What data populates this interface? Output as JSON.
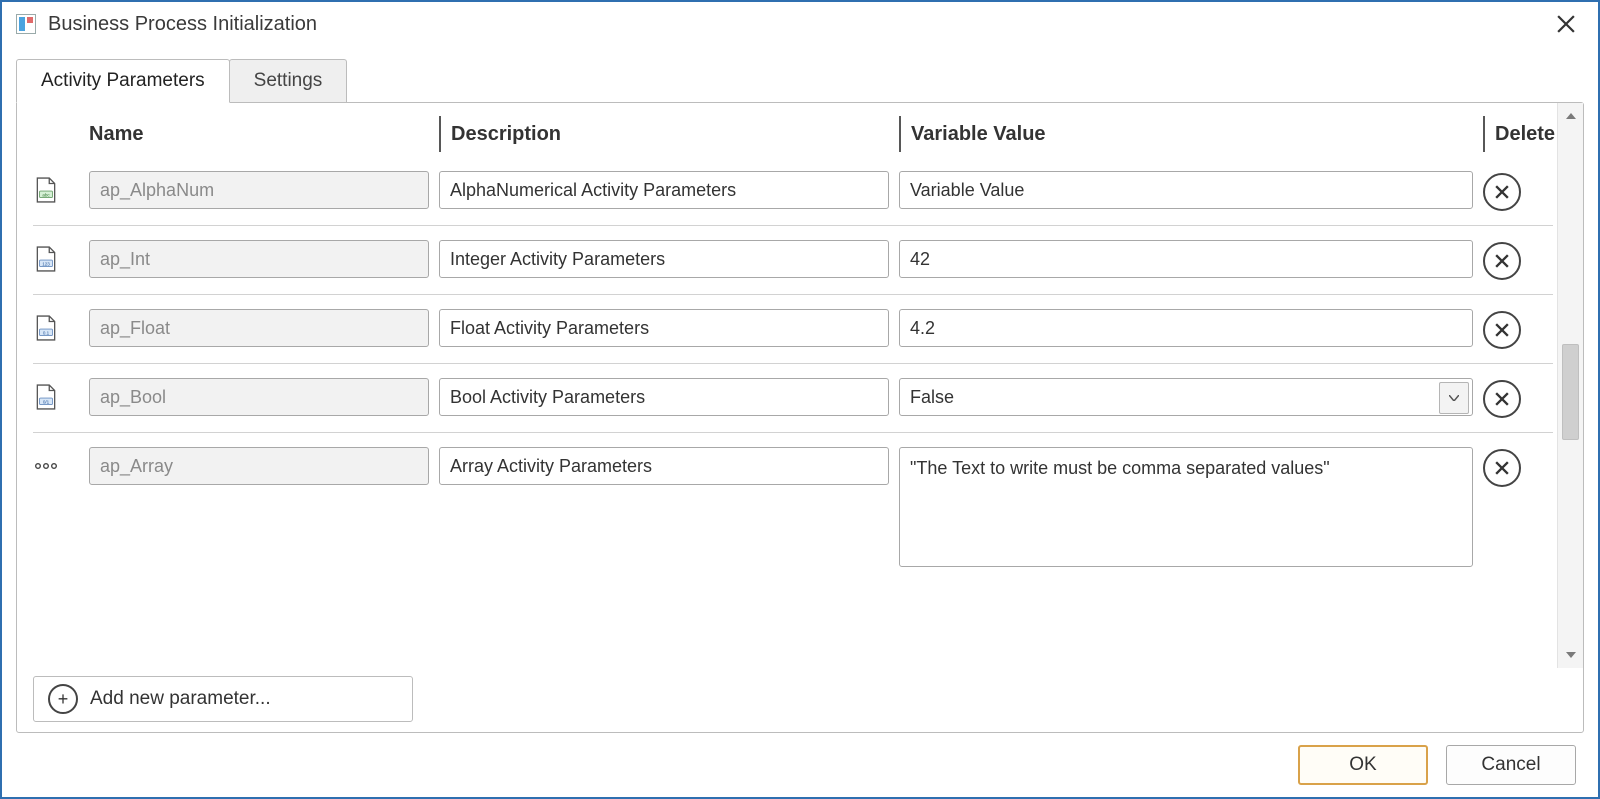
{
  "window": {
    "title": "Business Process Initialization"
  },
  "tabs": {
    "activity_parameters": "Activity Parameters",
    "settings": "Settings"
  },
  "columns": {
    "name": "Name",
    "description": "Description",
    "value": "Variable Value",
    "delete": "Delete"
  },
  "rows": [
    {
      "type_icon": "file-abc",
      "name": "ap_AlphaNum",
      "description": "AlphaNumerical Activity Parameters",
      "value_kind": "text",
      "value": "Variable Value"
    },
    {
      "type_icon": "file-123",
      "name": "ap_Int",
      "description": "Integer Activity Parameters",
      "value_kind": "text",
      "value": "42"
    },
    {
      "type_icon": "file-0point",
      "name": "ap_Float",
      "description": "Float Activity Parameters",
      "value_kind": "text",
      "value": "4.2"
    },
    {
      "type_icon": "file-01",
      "name": "ap_Bool",
      "description": "Bool Activity Parameters",
      "value_kind": "select",
      "value": "False"
    },
    {
      "type_icon": "dots",
      "name": "ap_Array",
      "description": "Array Activity Parameters",
      "value_kind": "textarea",
      "value": "\"The Text to write must be comma separated values\""
    }
  ],
  "add_parameter_label": "Add new parameter...",
  "footer": {
    "ok": "OK",
    "cancel": "Cancel"
  }
}
